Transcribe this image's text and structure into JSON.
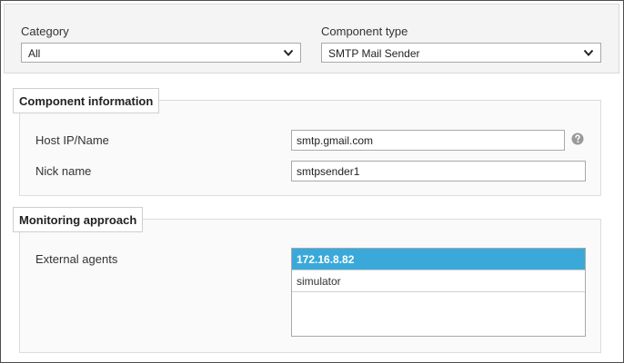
{
  "filters": {
    "category_label": "Category",
    "category_value": "All",
    "component_type_label": "Component type",
    "component_type_value": "SMTP Mail Sender"
  },
  "component_info": {
    "legend": "Component information",
    "host_label": "Host IP/Name",
    "host_value": "smtp.gmail.com",
    "nick_label": "Nick name",
    "nick_value": "smtpsender1",
    "help_icon": "question-circle-icon"
  },
  "monitoring": {
    "legend": "Monitoring approach",
    "agents_label": "External agents",
    "agents": [
      {
        "label": "172.16.8.82",
        "selected": true
      },
      {
        "label": "simulator",
        "selected": false
      }
    ]
  },
  "colors": {
    "selected_item": "#3aa9d9",
    "panel_bg": "#f4f4f4",
    "border": "#a9a9a9"
  }
}
